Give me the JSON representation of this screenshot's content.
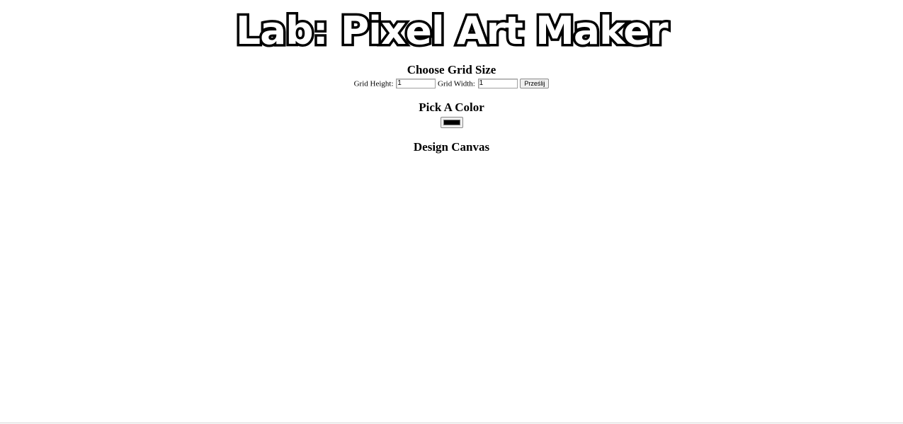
{
  "header": {
    "title": "Lab: Pixel Art Maker"
  },
  "grid_size": {
    "heading": "Choose Grid Size",
    "height_label": "Grid Height:",
    "height_value": "1",
    "width_label": "Grid Width:",
    "width_value": "1",
    "submit_label": "Prześlij"
  },
  "color_picker": {
    "heading": "Pick A Color",
    "value": "#000000"
  },
  "canvas": {
    "heading": "Design Canvas"
  }
}
